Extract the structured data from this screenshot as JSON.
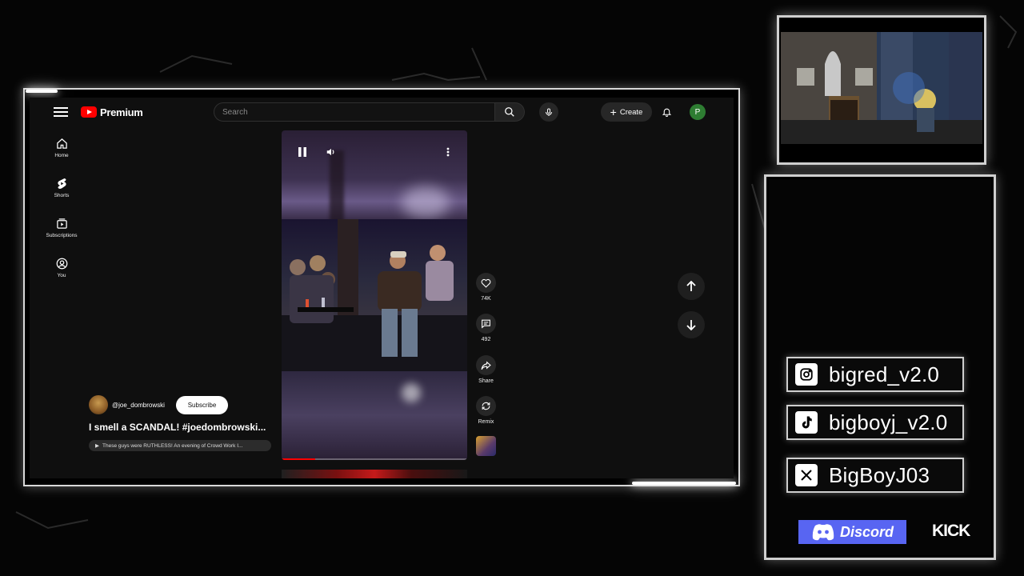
{
  "youtube": {
    "logo_text": "Premium",
    "search": {
      "placeholder": "Search"
    },
    "create_label": "Create",
    "avatar_initial": "P",
    "avatar_color": "#2e7d32",
    "guide": [
      {
        "label": "Home",
        "icon": "home-icon"
      },
      {
        "label": "Shorts",
        "icon": "shorts-icon"
      },
      {
        "label": "Subscriptions",
        "icon": "subscriptions-icon"
      },
      {
        "label": "You",
        "icon": "you-icon"
      }
    ],
    "short": {
      "channel": "@joe_dombrowski",
      "subscribe_label": "Subscribe",
      "title": "I smell a SCANDAL! #joedombrowski...",
      "related": "These guys were RUTHLESS! An evening of Crowd Work I...",
      "progress": 0.18
    },
    "actions": {
      "like_count": "74K",
      "comment_count": "492",
      "share_label": "Share",
      "remix_label": "Remix"
    }
  },
  "socials": {
    "instagram": "bigred_v2.0",
    "tiktok": "bigboyj_v2.0",
    "x": "BigBoyJ03",
    "discord": "Discord",
    "kick": "KICK"
  },
  "colors": {
    "accent_red": "#ff0000",
    "discord_blurple": "#5865f2"
  }
}
